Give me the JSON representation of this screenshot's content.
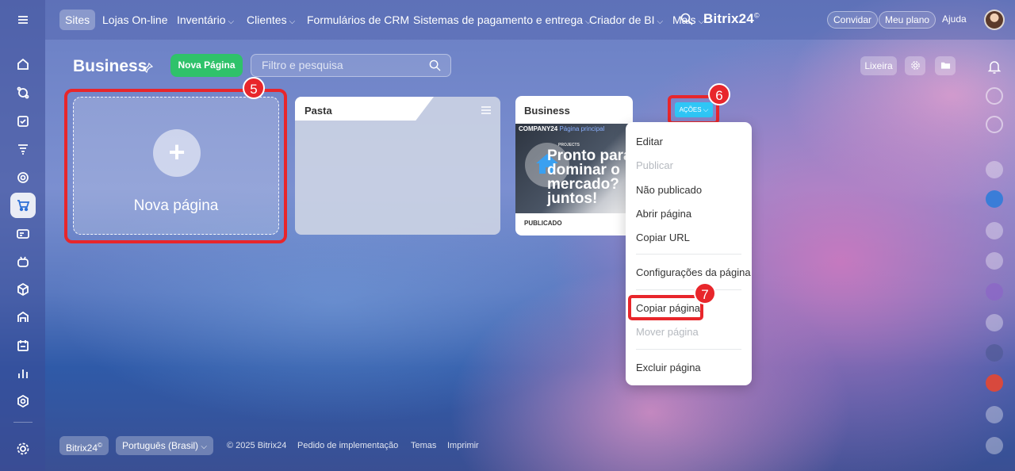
{
  "topnav": {
    "items": [
      {
        "label": "Sites",
        "active": true,
        "chevron": false
      },
      {
        "label": "Lojas On-line",
        "chevron": false
      },
      {
        "label": "Inventário",
        "chevron": true
      },
      {
        "label": "Clientes",
        "chevron": true
      },
      {
        "label": "Formulários de CRM",
        "chevron": false
      },
      {
        "label": "Sistemas de pagamento e entrega",
        "chevron": true
      },
      {
        "label": "Criador de BI",
        "chevron": true
      },
      {
        "label": "Mais",
        "chevron": true
      }
    ],
    "chevron_glyph": "⌵",
    "brand": "Bitrix24",
    "brand_mark": "©",
    "invite": "Convidar",
    "plan": "Meu plano",
    "help": "Ajuda"
  },
  "page": {
    "title": "Business",
    "new_page_button": "Nova Página",
    "filter_placeholder": "Filtro e pesquisa",
    "trash_button": "Lixeira"
  },
  "tiles": {
    "new_tile_label": "Nova página",
    "plus_glyph": "+",
    "folder_label": "Pasta",
    "site": {
      "title": "Business",
      "preview_company": "COMPANY24",
      "preview_main": "Página principal",
      "preview_projects": "PROJECTS",
      "preview_headline_1": "Pronto para",
      "preview_headline_2": "dominar o",
      "preview_headline_3": "mercado?",
      "preview_headline_4": "juntos!",
      "status": "PUBLICADO"
    }
  },
  "actions_button": "Ações",
  "actions_chevron": "⌵",
  "dropdown": {
    "edit": "Editar",
    "publish": "Publicar",
    "unpublished": "Não publicado",
    "open_page": "Abrir página",
    "copy_url": "Copiar URL",
    "page_settings": "Configurações da página",
    "copy_page": "Copiar página",
    "move_page": "Mover página",
    "delete_page": "Excluir página"
  },
  "badges": {
    "five": "5",
    "six": "6",
    "seven": "7"
  },
  "footer": {
    "brand": "Bitrix24",
    "brand_mark": "©",
    "language": "Português (Brasil)",
    "language_chevron": "⌵",
    "copyright": "© 2025 Bitrix24",
    "implementation": "Pedido de implementação",
    "themes": "Temas",
    "print": "Imprimir"
  },
  "colors": {
    "accent": "#2fc6f6",
    "green": "#2fc26a",
    "highlight": "#e8262b"
  }
}
